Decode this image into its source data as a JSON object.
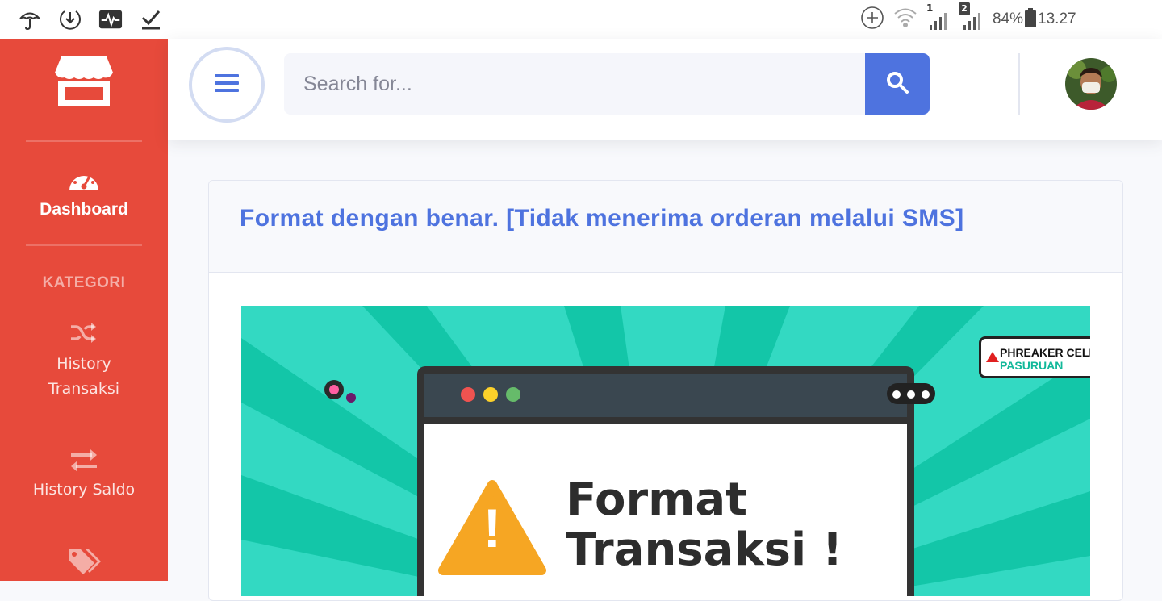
{
  "status_bar": {
    "left_icons": [
      "umbrella-icon",
      "download-icon",
      "activity-icon",
      "check-icon"
    ],
    "sim1": "1",
    "sim2": "2",
    "battery": "84%",
    "time": "13.27"
  },
  "sidebar": {
    "dashboard_label": "Dashboard",
    "category_heading": "KATEGORI",
    "items": [
      {
        "line1": "History",
        "line2": "Transaksi",
        "icon": "shuffle-icon"
      },
      {
        "line1": "History Saldo",
        "icon": "exchange-icon"
      },
      {
        "icon": "tags-icon"
      }
    ]
  },
  "topbar": {
    "search_placeholder": "Search for..."
  },
  "card": {
    "marquee_text": "Format dengan benar. [Tidak menerima orderan melalui SMS]"
  },
  "banner": {
    "brand_line1": "PHREAKER CELL",
    "brand_line2": "PASURUAN",
    "heading_line1": "Format",
    "heading_line2": "Transaksi !"
  },
  "colors": {
    "sidebar": "#e74a3b",
    "primary": "#4e73df",
    "banner_teal": "#13c6a8",
    "warning": "#f6a623"
  }
}
